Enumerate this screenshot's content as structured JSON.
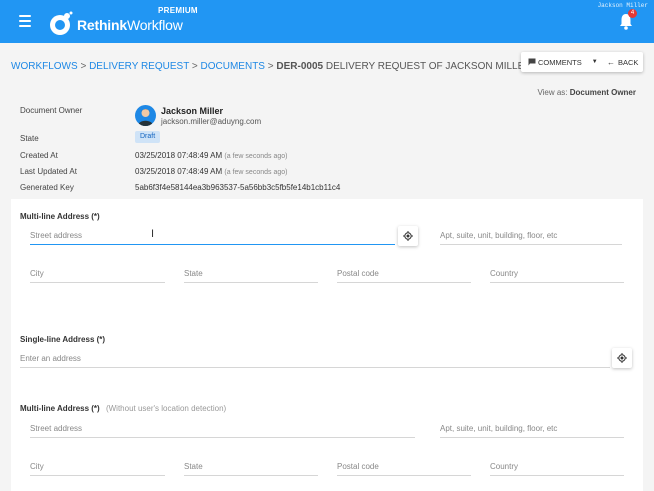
{
  "header": {
    "brand_bold": "Rethink",
    "brand_light": "Workflow",
    "edition": "PREMIUM",
    "user_name": "Jackson Miller",
    "notification_count": "4",
    "colors": {
      "primary": "#2196f3",
      "badge": "#e53935"
    }
  },
  "breadcrumb": {
    "items": [
      "WORKFLOWS",
      "DELIVERY REQUEST",
      "DOCUMENTS"
    ],
    "separator": ">",
    "current_code": "DER-0005",
    "current_title": "DELIVERY REQUEST OF JACKSON MILLER"
  },
  "actions": {
    "comments_label": "COMMENTS",
    "back_label": "BACK"
  },
  "view_as": {
    "prefix": "View as:",
    "role": "Document Owner"
  },
  "info": {
    "owner_label": "Document Owner",
    "owner_name": "Jackson Miller",
    "owner_email": "jackson.miller@aduyng.com",
    "state_label": "State",
    "state_value": "Draft",
    "created_label": "Created At",
    "created_value": "03/25/2018 07:48:49 AM",
    "created_relative": "(a few seconds ago)",
    "updated_label": "Last Updated At",
    "updated_value": "03/25/2018 07:48:49 AM",
    "updated_relative": "(a few seconds ago)",
    "key_label": "Generated Key",
    "key_value": "5ab6f3f4e58144ea3b963537-5a56bb3c5fb5fe14b1cb11c4"
  },
  "form": {
    "multi1": {
      "title": "Multi-line Address (*)",
      "street_placeholder": "Street address",
      "apt_placeholder": "Apt, suite, unit, building, floor, etc",
      "city_placeholder": "City",
      "state_placeholder": "State",
      "postal_placeholder": "Postal code",
      "country_placeholder": "Country"
    },
    "single": {
      "title": "Single-line Address (*)",
      "placeholder": "Enter an address"
    },
    "multi2": {
      "title": "Multi-line Address (*)",
      "hint": "(Without user's location detection)",
      "street_placeholder": "Street address",
      "apt_placeholder": "Apt, suite, unit, building, floor, etc",
      "city_placeholder": "City",
      "state_placeholder": "State",
      "postal_placeholder": "Postal code",
      "country_placeholder": "Country"
    }
  },
  "icons": [
    "menu-icon",
    "logo-icon",
    "bell-icon",
    "comment-icon",
    "chevron-down-icon",
    "arrow-left-icon",
    "my-location-icon",
    "text-cursor-icon"
  ]
}
